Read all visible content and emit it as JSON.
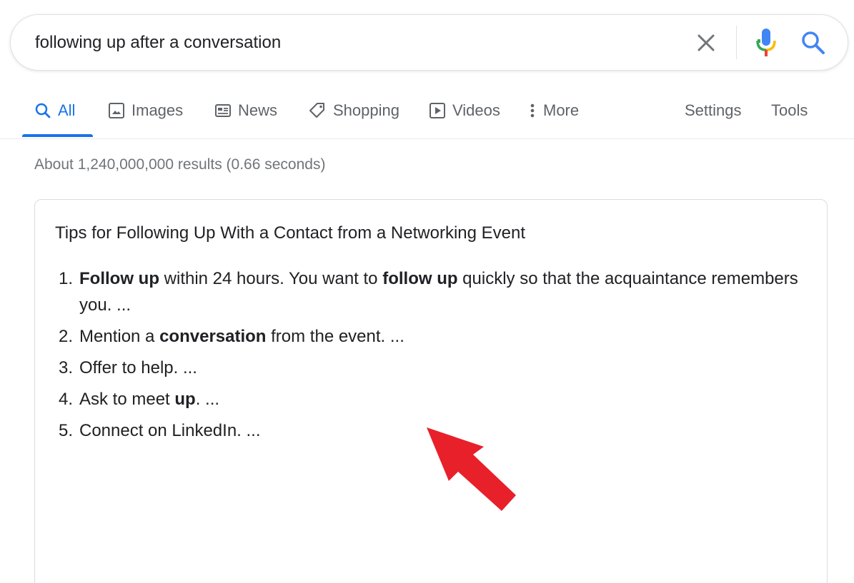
{
  "search": {
    "query": "following up after a conversation"
  },
  "tabs": [
    {
      "label": "All",
      "icon": "search-icon"
    },
    {
      "label": "Images",
      "icon": "image-icon"
    },
    {
      "label": "News",
      "icon": "news-icon"
    },
    {
      "label": "Shopping",
      "icon": "tag-icon"
    },
    {
      "label": "Videos",
      "icon": "play-icon"
    },
    {
      "label": "More",
      "icon": "more-vert-icon"
    }
  ],
  "settings_label": "Settings",
  "tools_label": "Tools",
  "result_stats": "About 1,240,000,000 results (0.66 seconds)",
  "snippet": {
    "title": "Tips for Following Up With a Contact from a Networking Event",
    "items": [
      {
        "num": "1.",
        "parts": [
          {
            "text": "Follow up",
            "bold": true
          },
          {
            "text": " within 24 hours. You want to "
          },
          {
            "text": "follow up",
            "bold": true
          },
          {
            "text": " quickly so that the acquaintance remembers you. ..."
          }
        ]
      },
      {
        "num": "2.",
        "parts": [
          {
            "text": "Mention a "
          },
          {
            "text": "conversation",
            "bold": true
          },
          {
            "text": " from the event. ..."
          }
        ]
      },
      {
        "num": "3.",
        "parts": [
          {
            "text": "Offer to help. ..."
          }
        ]
      },
      {
        "num": "4.",
        "parts": [
          {
            "text": "Ask to meet "
          },
          {
            "text": "up",
            "bold": true
          },
          {
            "text": ". ..."
          }
        ]
      },
      {
        "num": "5.",
        "parts": [
          {
            "text": "Connect on LinkedIn. ..."
          }
        ]
      }
    ]
  },
  "colors": {
    "accent": "#1a73e8",
    "arrow": "#e8202a",
    "mic_blue": "#4285f4",
    "mic_red": "#ea4335",
    "mic_yellow": "#fbbc04",
    "mic_green": "#34a853"
  }
}
